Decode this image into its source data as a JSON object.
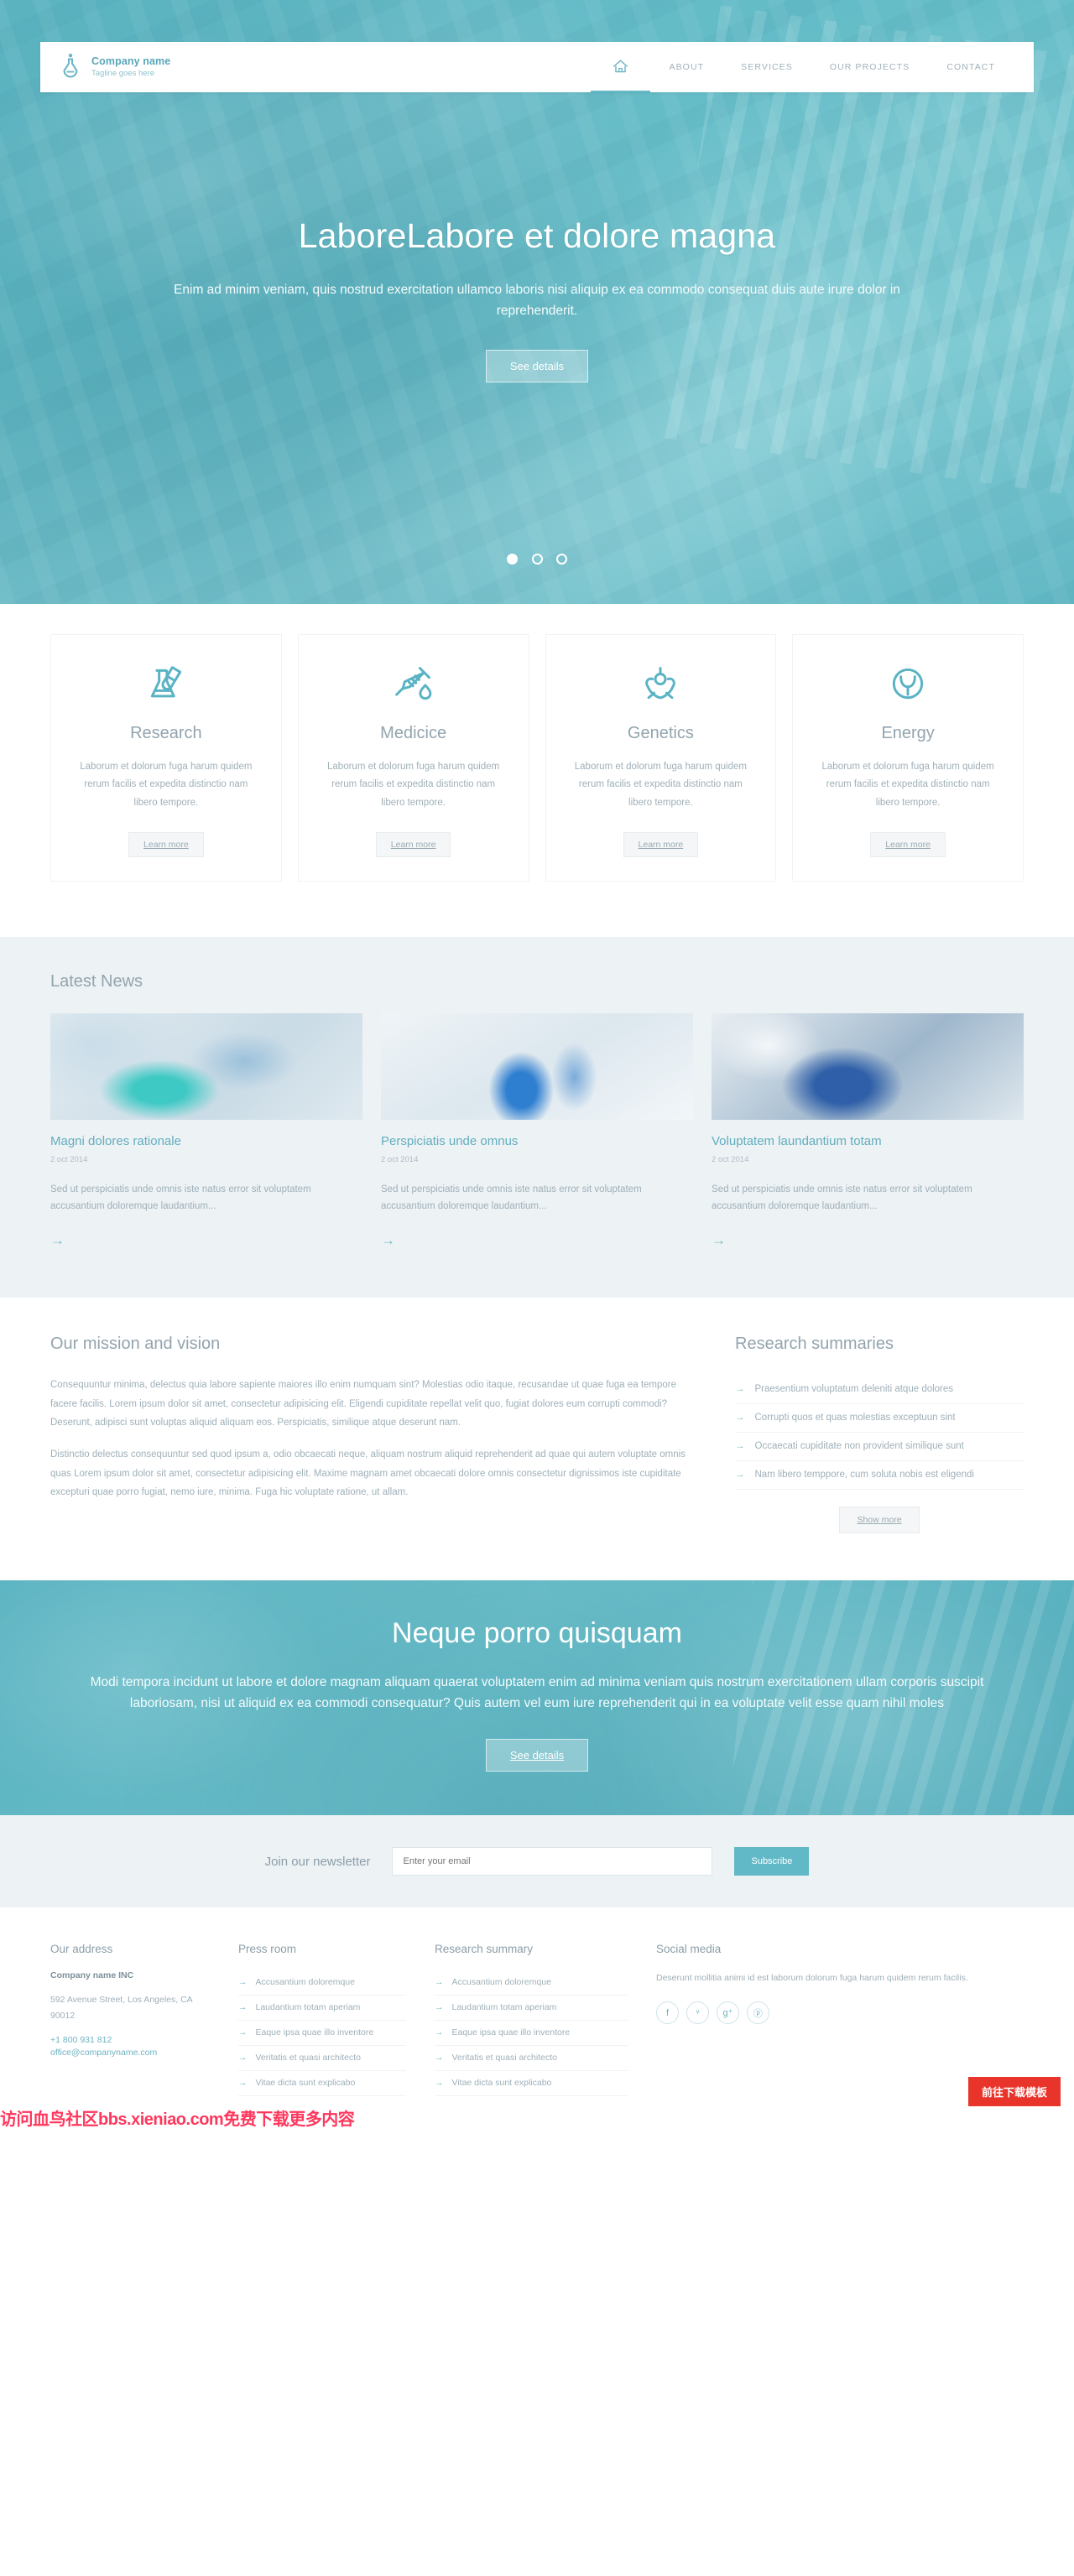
{
  "brand": {
    "name": "Company name",
    "tagline": "Tagline goes here",
    "icon": "flask-logo-icon"
  },
  "nav": {
    "home_icon": "home-icon",
    "items": [
      {
        "label": "ABOUT"
      },
      {
        "label": "SERVICES"
      },
      {
        "label": "OUR PROJECTS"
      },
      {
        "label": "CONTACT"
      }
    ]
  },
  "hero": {
    "title": "LaboreLabore et dolore magna",
    "subtitle": "Enim ad minim veniam, quis nostrud exercitation ullamco laboris nisi aliquip ex ea commodo consequat duis aute irure dolor in reprehenderit.",
    "button": "See details",
    "dots": 3,
    "active_dot": 1
  },
  "services": {
    "cards": [
      {
        "icon": "flask-test-tube-icon",
        "title": "Research",
        "text": "Laborum et dolorum fuga harum quidem rerum facilis et expedita distinctio nam libero tempore.",
        "button": "Learn more"
      },
      {
        "icon": "syringe-drop-icon",
        "title": "Medicice",
        "text": "Laborum et dolorum fuga harum quidem rerum facilis et expedita distinctio nam libero tempore.",
        "button": "Learn more"
      },
      {
        "icon": "dna-atom-icon",
        "title": "Genetics",
        "text": "Laborum et dolorum fuga harum quidem rerum facilis et expedita distinctio nam libero tempore.",
        "button": "Learn more"
      },
      {
        "icon": "energy-leaf-circle-icon",
        "title": "Energy",
        "text": "Laborum et dolorum fuga harum quidem rerum facilis et expedita distinctio nam libero tempore.",
        "button": "Learn more"
      }
    ]
  },
  "news": {
    "heading": "Latest News",
    "items": [
      {
        "title": "Magni dolores rationale",
        "date": "2 oct 2014",
        "excerpt": "Sed ut perspiciatis unde omnis iste natus error sit voluptatem accusantium doloremque laudantium...",
        "arrow": "→"
      },
      {
        "title": "Perspiciatis unde omnus",
        "date": "2 oct 2014",
        "excerpt": "Sed ut perspiciatis unde omnis iste natus error sit voluptatem accusantium doloremque laudantium...",
        "arrow": "→"
      },
      {
        "title": "Voluptatem laundantium totam",
        "date": "2 oct 2014",
        "excerpt": "Sed ut perspiciatis unde omnis iste natus error sit voluptatem accusantium doloremque laudantium...",
        "arrow": "→"
      }
    ]
  },
  "mission": {
    "heading": "Our mission and vision",
    "paragraph1": "Consequuntur minima, delectus quia labore sapiente maiores illo enim numquam sint? Molestias odio itaque, recusandae ut quae fuga ea tempore facere facilis. Lorem ipsum dolor sit amet, consectetur adipisicing elit. Eligendi cupiditate repellat velit quo, fugiat dolores eum corrupti commodi? Deserunt, adipisci sunt voluptas aliquid aliquam eos. Perspiciatis, similique atque deserunt nam.",
    "paragraph2": "Distinctio delectus consequuntur sed quod ipsum a, odio obcaecati neque, aliquam nostrum aliquid reprehenderit ad quae qui autem voluptate omnis quas Lorem ipsum dolor sit amet, consectetur adipisicing elit. Maxime magnam amet obcaecati dolore omnis consectetur dignissimos iste cupiditate excepturi quae porro fugiat, nemo iure, minima. Fuga hic voluptate ratione, ut allam."
  },
  "summaries": {
    "heading": "Research summaries",
    "items": [
      "Praesentium voluptatum deleniti atque dolores",
      "Corrupti quos et quas molestias exceptuun sint",
      "Occaecati cupiditate non provident similique sunt",
      "Nam libero temppore, cum soluta nobis est eligendi"
    ],
    "arrow": "→",
    "button": "Show more"
  },
  "cta": {
    "title": "Neque porro quisquam",
    "text": "Modi tempora incidunt ut labore et dolore magnam aliquam quaerat voluptatem enim ad minima veniam quis nostrum exercitationem ullam corporis suscipit laboriosam, nisi ut aliquid ex ea commodi consequatur? Quis autem vel eum iure reprehenderit qui in ea voluptate velit esse quam nihil moles",
    "button": "See details"
  },
  "newsletter": {
    "label": "Join our newsletter",
    "placeholder": "Enter your email",
    "value": "",
    "button": "Subscribe"
  },
  "footer": {
    "address": {
      "heading": "Our address",
      "company": "Company name INC",
      "street": "592 Avenue Street, Los Angeles, CA 90012",
      "phone": "+1 800 931 812",
      "email": "office@companyname.com"
    },
    "press": {
      "heading": "Press room",
      "items": [
        "Accusantium doloremque",
        "Laudantium totam aperiam",
        "Eaque ipsa quae illo inventore",
        "Veritatis et quasi architecto",
        "Vitae dicta sunt explicabo"
      ]
    },
    "summary": {
      "heading": "Research summary",
      "items": [
        "Accusantium doloremque",
        "Laudantium totam aperiam",
        "Eaque ipsa quae illo inventore",
        "Veritatis et quasi architecto",
        "Vitae dicta sunt explicabo"
      ]
    },
    "social": {
      "heading": "Social media",
      "text": "Deserunt mollitia animi id est laborum dolorum fuga harum quidem rerum facilis.",
      "icons": [
        {
          "name": "facebook-icon",
          "glyph": "f"
        },
        {
          "name": "twitter-icon",
          "glyph": "ᵛ"
        },
        {
          "name": "google-plus-icon",
          "glyph": "g⁺"
        },
        {
          "name": "pinterest-icon",
          "glyph": "ⓟ"
        }
      ]
    },
    "arrow": "→"
  },
  "overlay": {
    "watermark": "访问血鸟社区bbs.xieniao.com免费下载更多内容",
    "download_badge": "前往下载模板"
  },
  "colors": {
    "accent": "#61b9c8",
    "hero_teal": "#65bdc8",
    "muted_text": "#9fb0b9",
    "heading": "#93a4ae",
    "news_bg": "#edf2f5",
    "badge_red": "#e8342b"
  }
}
